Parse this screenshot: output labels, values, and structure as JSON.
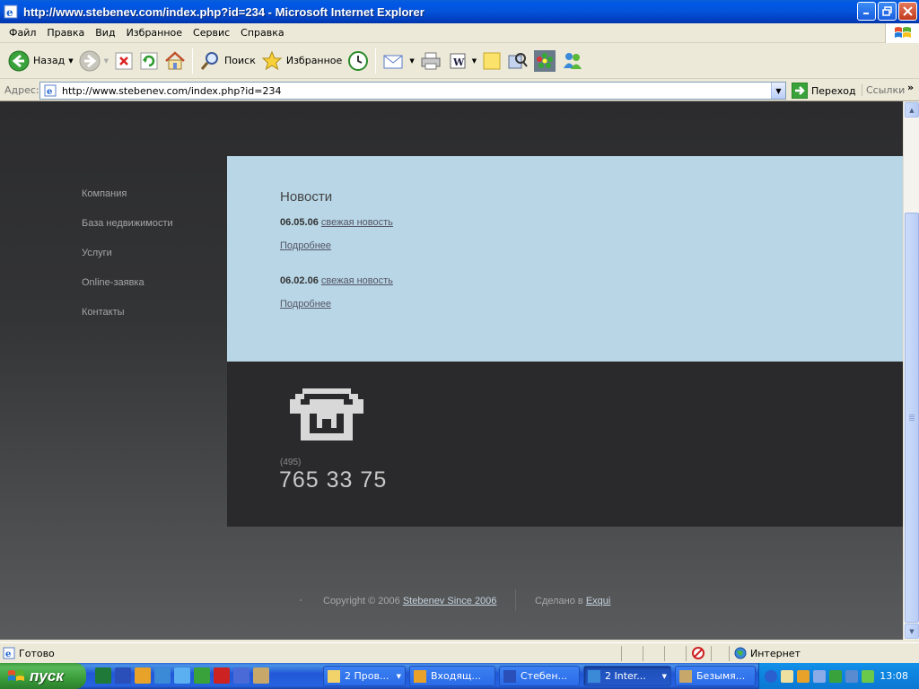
{
  "window": {
    "title": "http://www.stebenev.com/index.php?id=234 - Microsoft Internet Explorer"
  },
  "menu": [
    "Файл",
    "Правка",
    "Вид",
    "Избранное",
    "Сервис",
    "Справка"
  ],
  "toolbar": {
    "back_label": "Назад",
    "search_label": "Поиск",
    "favorites_label": "Избранное"
  },
  "address": {
    "label": "Адрес:",
    "url": "http://www.stebenev.com/index.php?id=234",
    "go_label": "Переход",
    "links_label": "Ссылки",
    "more": "»"
  },
  "page": {
    "nav": [
      "Компания",
      "База недвижимости",
      "Услуги",
      "Online-заявка",
      "Контакты"
    ],
    "news_title": "Новости",
    "news": [
      {
        "date": "06.05.06",
        "link": "свежая новость",
        "more": "Подробнее"
      },
      {
        "date": "06.02.06",
        "link": "свежая новость",
        "more": "Подробнее"
      }
    ],
    "phone_code": "(495)",
    "phone_number": "765 33 75",
    "footer": {
      "copyright_prefix": "Copyright © 2006",
      "copyright_link": "Stebenev Since 2006",
      "made_prefix": "Сделано в",
      "made_link": "Exqui"
    }
  },
  "status": {
    "text": "Готово",
    "zone": "Интернет"
  },
  "taskbar": {
    "start_label": "пуск",
    "tasks": [
      "2 Пров...",
      "Входящ...",
      "Стебен...",
      "2 Inter...",
      "Безымя..."
    ],
    "clock": "13:08"
  },
  "colors": {
    "news_bg": "#b8d6e6",
    "phone_bg": "#2a2a2c",
    "page_bg": "#333436"
  }
}
